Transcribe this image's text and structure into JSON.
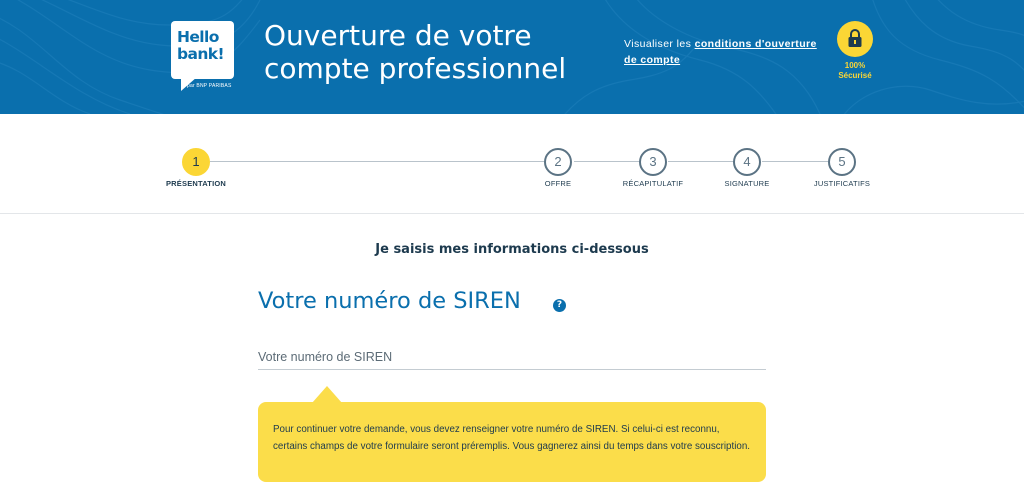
{
  "brand": {
    "logo_line1": "Hello",
    "logo_line2": "bank!",
    "logo_sub": "par BNP PARIBAS",
    "primary_color": "#0a6fad",
    "accent_color": "#fbd635"
  },
  "header": {
    "title_line1": "Ouverture de votre",
    "title_line2": "compte professionnel",
    "conditions_prefix": "Visualiser les",
    "conditions_link": "conditions d'ouverture",
    "conditions_link2": "de compte",
    "secure_percent": "100%",
    "secure_label": "Sécurisé",
    "secure_icon": "lock-icon"
  },
  "stepper": {
    "active_step": 1,
    "steps": [
      {
        "number": "1",
        "label": "PRÉSENTATION"
      },
      {
        "number": "2",
        "label": "OFFRE"
      },
      {
        "number": "3",
        "label": "RÉCAPITULATIF"
      },
      {
        "number": "4",
        "label": "SIGNATURE"
      },
      {
        "number": "5",
        "label": "JUSTIFICATIFS"
      }
    ]
  },
  "main": {
    "subtitle": "Je saisis mes informations ci-dessous",
    "section_title": "Votre numéro de SIREN",
    "help_icon": "help-icon",
    "help_glyph": "?",
    "siren_placeholder": "Votre numéro de SIREN",
    "siren_value": "",
    "info_text": "Pour continuer votre demande, vous devez renseigner votre numéro de SIREN. Si celui-ci est reconnu, certains champs de votre formulaire seront préremplis. Vous gagnerez ainsi du temps dans votre souscription."
  }
}
